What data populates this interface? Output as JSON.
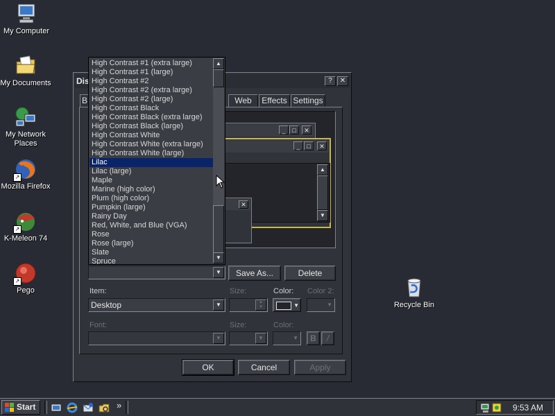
{
  "desktop": {
    "icons": [
      {
        "label": "My Computer"
      },
      {
        "label": "My Documents"
      },
      {
        "label": "My Network Places"
      },
      {
        "label": "Mozilla Firefox"
      },
      {
        "label": "K-Meleon 74"
      },
      {
        "label": "Pego"
      },
      {
        "label": "Recycle Bin"
      }
    ]
  },
  "dialog": {
    "title": "Disp",
    "help_button": "?",
    "close_button": "✕",
    "tabs": [
      "B",
      "Web",
      "Effects",
      "Settings"
    ],
    "preview": {
      "min": "_",
      "max": "□",
      "close": "✕"
    },
    "scheme": {
      "items": [
        "High Contrast #1 (extra large)",
        "High Contrast #1 (large)",
        "High Contrast #2",
        "High Contrast #2 (extra large)",
        "High Contrast #2 (large)",
        "High Contrast Black",
        "High Contrast Black (extra large)",
        "High Contrast Black (large)",
        "High Contrast White",
        "High Contrast White (extra large)",
        "High Contrast White (large)",
        "Lilac",
        "Lilac (large)",
        "Maple",
        "Marine (high color)",
        "Plum (high color)",
        "Pumpkin (large)",
        "Rainy Day",
        "Red, White, and Blue (VGA)",
        "Rose",
        "Rose (large)",
        "Slate",
        "Spruce"
      ],
      "selected_index": 11,
      "save_as_label": "Save As...",
      "delete_label": "Delete"
    },
    "item_label": "Item:",
    "item_value": "Desktop",
    "size_label": "Size:",
    "color_label": "Color:",
    "color2_label": "Color 2:",
    "font_label": "Font:",
    "font_size_label": "Size:",
    "font_color_label": "Color:",
    "bold_label": "B",
    "italic_label": "/",
    "ok_label": "OK",
    "cancel_label": "Cancel",
    "apply_label": "Apply"
  },
  "taskbar": {
    "start_label": "Start",
    "chevron": "»",
    "clock": "9:53 AM"
  }
}
